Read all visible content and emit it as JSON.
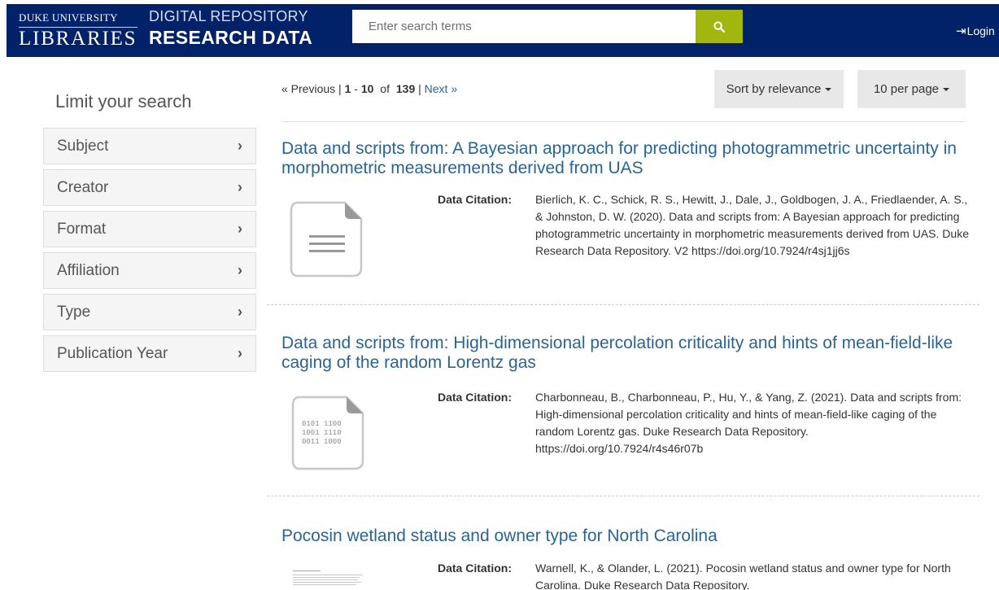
{
  "header": {
    "brand_top": "DUKE UNIVERSITY",
    "brand_bottom": "LIBRARIES",
    "repo_top": "DIGITAL REPOSITORY",
    "repo_bottom": "RESEARCH DATA",
    "search_placeholder": "Enter search terms",
    "search_icon": "search-icon",
    "login_label": "Login",
    "login_icon": "login-icon"
  },
  "sidebar": {
    "title": "Limit your search",
    "facets": [
      {
        "label": "Subject"
      },
      {
        "label": "Creator"
      },
      {
        "label": "Format"
      },
      {
        "label": "Affiliation"
      },
      {
        "label": "Type"
      },
      {
        "label": "Publication Year"
      }
    ]
  },
  "pagination": {
    "previous": "« Previous",
    "range_start": "1",
    "range_end": "10",
    "of_text": "of",
    "total": "139",
    "next": "Next »"
  },
  "sort": {
    "relevance_label": "Sort by relevance",
    "per_page_label": "10 per page"
  },
  "results": [
    {
      "title": "Data and scripts from: A Bayesian approach for predicting photogrammetric uncertainty in morphometric measurements derived from UAS",
      "citation_label": "Data Citation:",
      "citation": "Bierlich, K. C., Schick, R. S., Hewitt, J., Dale, J., Goldbogen, J. A., Friedlaender, A. S., & Johnston, D. W. (2020). Data and scripts from: A Bayesian approach for predicting photogrammetric uncertainty in morphometric measurements derived from UAS. Duke Research Data Repository. V2 https://doi.org/10.7924/r4sj1jj6s",
      "thumbnail": "document-icon"
    },
    {
      "title": "Data and scripts from: High-dimensional percolation criticality and hints of mean-field-like caging of the random Lorentz gas",
      "citation_label": "Data Citation:",
      "citation": "Charbonneau, B., Charbonneau, P., Hu, Y., & Yang, Z. (2021). Data and scripts from: High-dimensional percolation criticality and hints of mean-field-like caging of the random Lorentz gas. Duke Research Data Repository. https://doi.org/10.7924/r4s46r07b",
      "thumbnail": "binary-file-icon",
      "thumbnail_text": [
        "0101 1100",
        "1001 1110",
        "0011 1000"
      ]
    },
    {
      "title": "Pocosin wetland status and owner type for North Carolina",
      "citation_label": "Data Citation:",
      "citation": "Warnell, K., & Olander, L. (2021). Pocosin wetland status and owner type for North Carolina. Duke Research Data Repository.",
      "thumbnail": "document-preview-thumbnail"
    }
  ],
  "colors": {
    "navbar": "#012169",
    "search_button": "#a1b70d",
    "link": "#2a6496"
  }
}
